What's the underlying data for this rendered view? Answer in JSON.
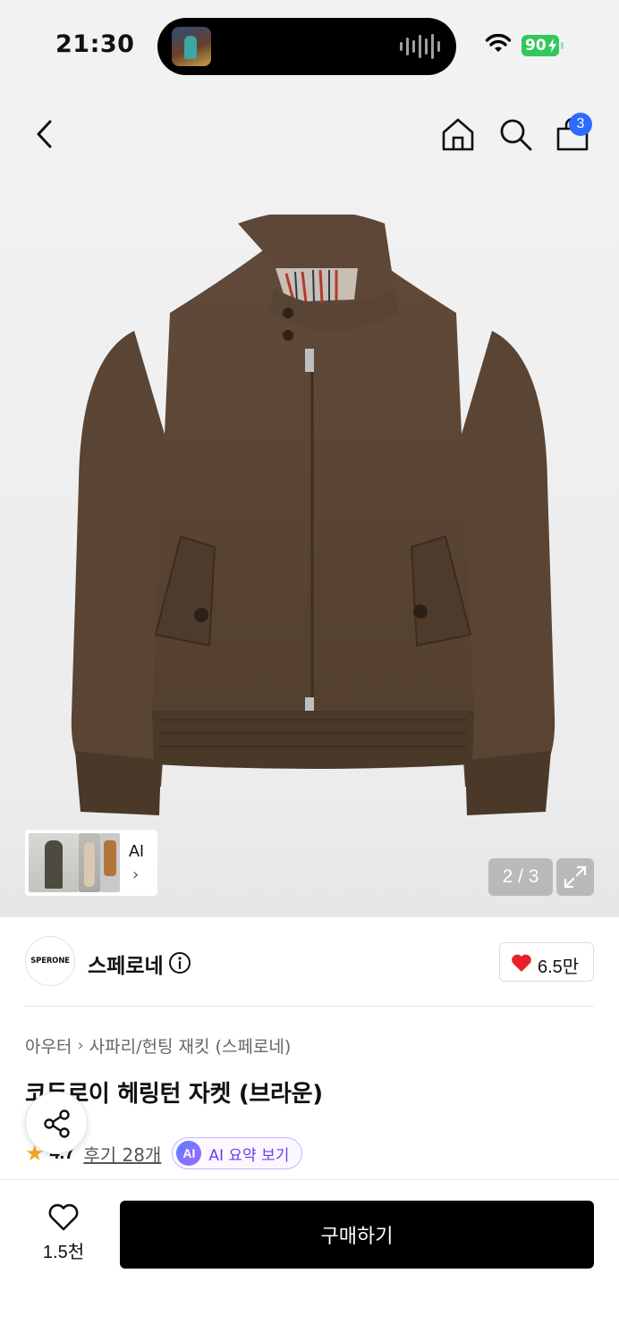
{
  "status_bar": {
    "time": "21:30",
    "battery": "90"
  },
  "header": {
    "cart_count": "3"
  },
  "gallery": {
    "thumbnail_label": "AI",
    "counter": "2 / 3"
  },
  "brand": {
    "logo_text": "SPERONE",
    "name": "스페로네",
    "likes": "6.5만"
  },
  "breadcrumb": {
    "category": "아우터",
    "subcategory": "사파리/헌팅 재킷 (스페로네)"
  },
  "product": {
    "title": "코듀로이 헤링턴 자켓 (브라운)",
    "rating": "4.7",
    "reviews": "후기 28개",
    "ai_badge": "AI",
    "ai_summary": "AI 요약 보기"
  },
  "bottom_bar": {
    "wishlist_count": "1.5천",
    "buy_label": "구매하기"
  },
  "colors": {
    "accent": "#2d6bff",
    "heart": "#e8202a",
    "star": "#f5a623",
    "ai": "#6b3cf0",
    "jacket": "#5b4535"
  }
}
